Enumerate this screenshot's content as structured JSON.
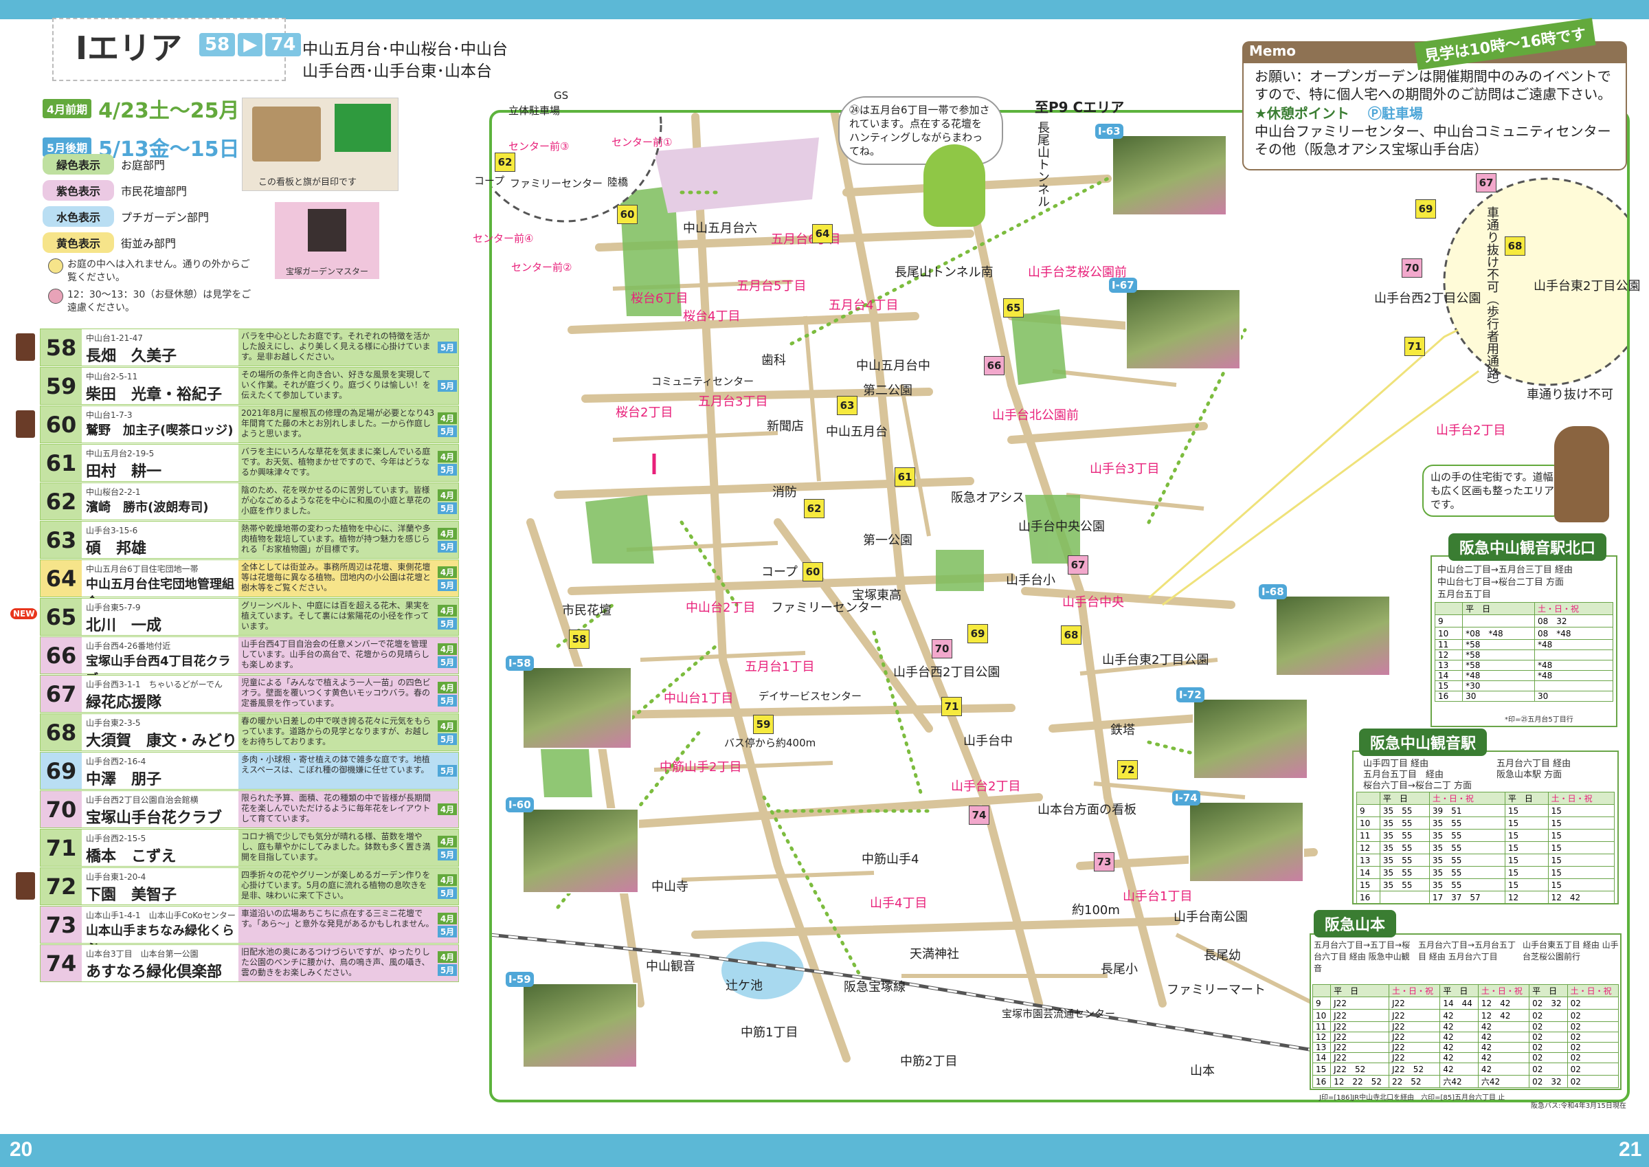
{
  "page": {
    "left_number": "20",
    "right_number": "21"
  },
  "area": {
    "title": "Iエリア",
    "range_start": "58",
    "range_end": "74",
    "subtitle_line1": "中山五月台･中山桜台･中山台",
    "subtitle_line2": "山手台西･山手台東･山本台"
  },
  "dates": [
    {
      "tag": "4月前期",
      "text": "4/23土〜25月",
      "color": "#63a93c"
    },
    {
      "tag": "5月後期",
      "text": "5/13金〜15日",
      "color": "#4fa7d8"
    }
  ],
  "legend": [
    {
      "chip": "緑色表示",
      "label": "お庭部門",
      "color": "#bfe0a0"
    },
    {
      "chip": "紫色表示",
      "label": "市民花壇部門",
      "color": "#ebc9e3"
    },
    {
      "chip": "水色表示",
      "label": "プチガーデン部門",
      "color": "#b9def3"
    },
    {
      "chip": "黄色表示",
      "label": "街並み部門",
      "color": "#f6e48a"
    }
  ],
  "notes": [
    "お庭の中へは入れません。通りの外からご覧ください。",
    "12：30〜13：30（お昼休憩）は見学をご遠慮ください。"
  ],
  "photos_left": {
    "sign_caption": "この看板と旗が目印です",
    "master_caption": "宝塚ガーデンマスター"
  },
  "gardens": [
    {
      "num": "58",
      "addr": "中山台1-21-47",
      "name": "長畑　久美子",
      "desc": "バラを中心としたお庭です。それぞれの特徴を活かした設えにし、より美しく見える様に心掛けています。是非お越しください。",
      "months": [
        "5月"
      ],
      "color": "#c5e3a3",
      "medal": true,
      "new": false
    },
    {
      "num": "59",
      "addr": "中山台2-5-11",
      "name": "柴田　光章・裕紀子",
      "desc": "その場所の条件と向き合い、好きな風景を実現していく作業。それが庭づくり。庭づくりは愉しい！を伝えたくて参加しています。",
      "months": [
        "5月"
      ],
      "color": "#c5e3a3",
      "medal": false,
      "new": false
    },
    {
      "num": "60",
      "addr": "中山台1-7-3",
      "name": "鷲野　加主子(喫茶ロッジ)",
      "desc": "2021年8月に屋根瓦の修理の為足場が必要となり43年間育てた藤の木とお別れしました。一から作庭しようと思います。",
      "months": [
        "4月",
        "5月"
      ],
      "color": "#c5e3a3",
      "medal": true,
      "new": false
    },
    {
      "num": "61",
      "addr": "中山五月台2-19-5",
      "name": "田村　耕一",
      "desc": "バラを主にいろんな草花を気ままに楽しんでいる庭です。お天気、植物まかせですので、今年はどうなるか興味津々です。",
      "months": [
        "4月",
        "5月"
      ],
      "color": "#c5e3a3",
      "medal": false,
      "new": false
    },
    {
      "num": "62",
      "addr": "中山桜台2-2-1",
      "name": "濱崎　勝市(波朗寿司)",
      "desc": "陰のため、花を咲かせるのに苦労しています。皆様が心なごめるような花を中心に和風の小庭と草花の小庭を作りました。",
      "months": [
        "4月",
        "5月"
      ],
      "color": "#c5e3a3",
      "medal": false,
      "new": false
    },
    {
      "num": "63",
      "addr": "山手台3-15-6",
      "name": "碩　邦雄",
      "desc": "熱帯や乾燥地帯の変わった植物を中心に、洋蘭や多肉植物を栽培しています。植物が持つ魅力を感じられる「お家植物園」が目標です。",
      "months": [
        "4月",
        "5月"
      ],
      "color": "#c5e3a3",
      "medal": false,
      "new": false
    },
    {
      "num": "64",
      "addr": "中山五月台6丁目住宅団地一帯",
      "name": "中山五月台住宅団地管理組合",
      "desc": "全体としては街並み。事務所周辺は花壇、東側花壇等は花壇毎に異なる植物。団地内の小公園は花壇と樹木等をご覧ください。",
      "months": [
        "4月",
        "5月"
      ],
      "color": "#f6e48a",
      "medal": false,
      "new": false
    },
    {
      "num": "65",
      "addr": "山手台東5-7-9",
      "name": "北川　一成",
      "desc": "グリーンベルト、中庭には百を超える花木、果実を植えています。そして裏には紫陽花の小径を作っています。",
      "months": [
        "4月",
        "5月"
      ],
      "color": "#c5e3a3",
      "medal": false,
      "new": true
    },
    {
      "num": "66",
      "addr": "山手台西4-26番地付近",
      "name": "宝塚山手台西4丁目花クラブ",
      "desc": "山手台西4丁目自治会の任意メンバーで花壇を管理しています。山手台の高台で、花壇からの見晴らしも楽しめます。",
      "months": [
        "4月",
        "5月"
      ],
      "color": "#ebc9e3",
      "medal": false,
      "new": false
    },
    {
      "num": "67",
      "addr": "山手台西3-1-1　ちゃいるどがーでん",
      "name": "緑花応援隊",
      "desc": "児童による「みんなで植えよう一人一苗」の四色ビオラ。壁面を覆いつくす黄色いモッコウバラ。春の定番風景を作っています。",
      "months": [
        "4月",
        "5月"
      ],
      "color": "#ebc9e3",
      "medal": false,
      "new": false
    },
    {
      "num": "68",
      "addr": "山手台東2-3-5",
      "name": "大須賀　康文・みどり",
      "desc": "春の暖かい日差しの中で咲き誇る花々に元気をもらっています。道路からの見学となりますが、お越しをお待ちしております。",
      "months": [
        "4月",
        "5月"
      ],
      "color": "#c5e3a3",
      "medal": false,
      "new": false
    },
    {
      "num": "69",
      "addr": "山手台西2-16-4",
      "name": "中澤　朋子",
      "desc": "多肉・小球根・寄せ植えの鉢で雑多な庭です。地植えスペースは、こぼれ種の御機嫌に任せています。",
      "months": [
        "5月"
      ],
      "color": "#b9def3",
      "medal": false,
      "new": false
    },
    {
      "num": "70",
      "addr": "山手台西2丁目公園自治会館横",
      "name": "宝塚山手台花クラブ",
      "desc": "限られた予算、面積、花の種類の中で皆様が長期間花を楽しんでいただけるように毎年花をレイアウトして育てています。",
      "months": [
        "4月"
      ],
      "color": "#ebc9e3",
      "medal": false,
      "new": false
    },
    {
      "num": "71",
      "addr": "山手台西2-15-5",
      "name": "橋本　こずえ",
      "desc": "コロナ禍で少しでも気分が晴れる様、苗数を増やし、庭も華やかにしてみました。鉢数も多く置き満開を目指しています。",
      "months": [
        "4月",
        "5月"
      ],
      "color": "#c5e3a3",
      "medal": false,
      "new": false
    },
    {
      "num": "72",
      "addr": "山手台東1-20-4",
      "name": "下園　美智子",
      "desc": "四季折々の花やグリーンが楽しめるガーデン作りを心掛けています。5月の庭に流れる植物の息吹きを是非、味わいに来て下さい。",
      "months": [
        "4月",
        "5月"
      ],
      "color": "#c5e3a3",
      "medal": true,
      "new": false
    },
    {
      "num": "73",
      "addr": "山本山手1-4-1　山本山手CoKoセンター",
      "name": "山本山手まちなみ緑化くらぶ",
      "desc": "車道沿いの広場あちこちに点在する三ミニ花壇です。「あら〜」と意外な発見があるかもしれません。",
      "months": [
        "4月",
        "5月"
      ],
      "color": "#ebc9e3",
      "medal": false,
      "new": false
    },
    {
      "num": "74",
      "addr": "山本台3丁目　山本台第一公園",
      "name": "あすなろ緑化倶楽部",
      "desc": "旧配水池の奥にあるつけづらいですが、ゆったりした公園のベンチに腰かけ、鳥の鳴き声、風の囁き、雲の動きをお楽しみください。",
      "months": [
        "4月",
        "5月"
      ],
      "color": "#ebc9e3",
      "medal": false,
      "new": false
    }
  ],
  "map": {
    "direction_label": "至P9 Cエリア",
    "tunnel_label": "長尾山トンネル",
    "callout_74": "㉔は五月台6丁目一帯で参加されています。点在する花壇をハンティングしながらまわってね。",
    "inset_labels": {
      "gs": "GS",
      "parking": "立体駐車場",
      "stop1": "センター前①",
      "stop2": "センター前②",
      "stop3": "センター前③",
      "stop4": "センター前④",
      "family_center": "ファミリーセンター",
      "coop": "コープ",
      "bridge": "陸橋",
      "pin60": "60",
      "pin62": "62"
    },
    "places": [
      "中山五月台六",
      "五月台6丁目",
      "五月台5丁目",
      "五月台4丁目",
      "長尾山トンネル南",
      "山手台芝桜公園前",
      "桜台6丁目",
      "桜台4丁目",
      "歯科",
      "コミュニティセンター",
      "五月台3丁目",
      "中山五月台中",
      "第二公園",
      "新聞店",
      "中山五月台",
      "桜台2丁目",
      "山手台北公園前",
      "消防",
      "阪急オアシス",
      "山手台3丁目",
      "第一公園",
      "宝塚東高",
      "山手台中央公園",
      "山手台小",
      "山手台中央",
      "市民花壇",
      "中山台2丁目",
      "五月台1丁目",
      "デイサービスセンター",
      "山手台西2丁目公園",
      "山手台東2丁目公園",
      "中山台1丁目",
      "鉄塔",
      "山手台中",
      "中筋山手2丁目",
      "山手台2丁目",
      "山本台方面の看板",
      "中筋山手4",
      "中山寺",
      "山手4丁目",
      "山手台1丁目",
      "山手台南公園",
      "天満神社",
      "長尾小",
      "長尾幼",
      "中山観音",
      "辻ケ池",
      "阪急宝塚線",
      "ファミリーマート",
      "宝塚市園芸流通センター",
      "中筋1丁目",
      "中筋2丁目",
      "山本",
      "約100m",
      "バス停から約400m",
      "ファミリーセンター",
      "コープ"
    ],
    "pins": [
      "58",
      "59",
      "60",
      "61",
      "62",
      "63",
      "64",
      "65",
      "66",
      "67",
      "68",
      "69",
      "70",
      "71",
      "72",
      "73",
      "74"
    ],
    "photo_tags": [
      "I-58",
      "I-59",
      "I-60",
      "I-63",
      "I-67",
      "I-68",
      "I-72",
      "I-74"
    ],
    "inset_right": {
      "street_note": "車通り抜け不可（歩行者用通路）",
      "park_east": "山手台東2丁目公園",
      "park_west": "山手台西2丁目公園",
      "no_pass": "車通り抜け不可",
      "yamate2": "山手台2丁目",
      "pins": [
        "67",
        "68",
        "69",
        "70",
        "71"
      ]
    },
    "mascot_speech": "山の手の住宅街です。道幅も広く区画も整ったエリアです。"
  },
  "memo": {
    "title": "Memo",
    "hours": "見学は10時〜16時です",
    "text1": "お願い：オープンガーデンは開催期間中のみのイベントですので、特に個人宅への期間外のご訪問はご遠慮下さい。",
    "rest_title": "★休憩ポイント",
    "parking_title": "Ⓟ駐車場",
    "text2": "中山台ファミリーセンター、中山台コミュニティセンターその他（阪急オアシス宝塚山手台店）"
  },
  "timetables": {
    "kita": {
      "title": "阪急中山観音駅北口",
      "route1": "中山台二丁目→五月台三丁目 経由",
      "route2": "中山台七丁目→桜台二丁目 方面",
      "route3": "五月台五丁目",
      "head": [
        "",
        "平　日",
        "土・日・祝"
      ],
      "rows": [
        [
          "9",
          "",
          "08　32"
        ],
        [
          "10",
          "*08　*48",
          "08　*48"
        ],
        [
          "11",
          "*58",
          "*48"
        ],
        [
          "12",
          "*58",
          ""
        ],
        [
          "13",
          "*58",
          "*48"
        ],
        [
          "14",
          "*48",
          "*48"
        ],
        [
          "15",
          "*30",
          ""
        ],
        [
          "16",
          "30",
          "30"
        ]
      ],
      "foot": "*印=㉕五月台5丁目行"
    },
    "station": {
      "title": "阪急中山観音駅",
      "col1": "山手四丁目 経由",
      "col1a": "五月台五丁目　経由",
      "col1b": "桜台六丁目→桜台二丁 方面",
      "col2": "五月台六丁目 経由",
      "col2b": "阪急山本駅 方面",
      "head": [
        "",
        "平　日",
        "土・日・祝",
        "平　日",
        "土・日・祝"
      ],
      "rows": [
        [
          "9",
          "35　55",
          "39　51",
          "15",
          "15"
        ],
        [
          "10",
          "35　55",
          "35　55",
          "15",
          "15"
        ],
        [
          "11",
          "35　55",
          "35　55",
          "15",
          "15"
        ],
        [
          "12",
          "35　55",
          "35　55",
          "15",
          "15"
        ],
        [
          "13",
          "35　55",
          "35　55",
          "15",
          "15"
        ],
        [
          "14",
          "35　55",
          "35　55",
          "15",
          "15"
        ],
        [
          "15",
          "35　55",
          "35　55",
          "15",
          "15"
        ],
        [
          "16",
          "",
          "17　37　57",
          "12",
          "12　42"
        ]
      ]
    },
    "yamamoto": {
      "title": "阪急山本",
      "col1": "五月台六丁目→五丁目→桜台六丁目 経由 阪急中山観音",
      "col2": "五月台六丁目→五月台五丁目 経由 五月台六丁目",
      "col3": "山手台東五丁目 経由 山手台芝桜公園前行",
      "head": [
        "",
        "平　日",
        "土・日・祝",
        "平　日",
        "土・日・祝",
        "平　日",
        "土・日・祝"
      ],
      "rows": [
        [
          "9",
          "J22",
          "J22",
          "14　44",
          "12　42",
          "02　32",
          "02"
        ],
        [
          "10",
          "J22",
          "J22",
          "42",
          "12　42",
          "02",
          "02"
        ],
        [
          "11",
          "J22",
          "J22",
          "42",
          "42",
          "02",
          "02"
        ],
        [
          "12",
          "J22",
          "J22",
          "42",
          "42",
          "02",
          "02"
        ],
        [
          "13",
          "J22",
          "J22",
          "42",
          "42",
          "02",
          "02"
        ],
        [
          "14",
          "J22",
          "J22",
          "42",
          "42",
          "02",
          "02"
        ],
        [
          "15",
          "J22　52",
          "J22　52",
          "42",
          "42",
          "02",
          "02"
        ],
        [
          "16",
          "12　22　52",
          "22　52",
          "六42",
          "六42",
          "02　32",
          "02"
        ]
      ],
      "foot": "J印=[186]JR中山寺北口を経由　六印=[85]五月台六丁目 止",
      "foot2": "阪急バス:令和4年3月15日現在"
    }
  },
  "colors": {
    "topbar": "#5cb8d6",
    "green": "#5db33d",
    "blue": "#4fa7d8",
    "pink": "#e8207a",
    "road": "#d8c49a"
  }
}
